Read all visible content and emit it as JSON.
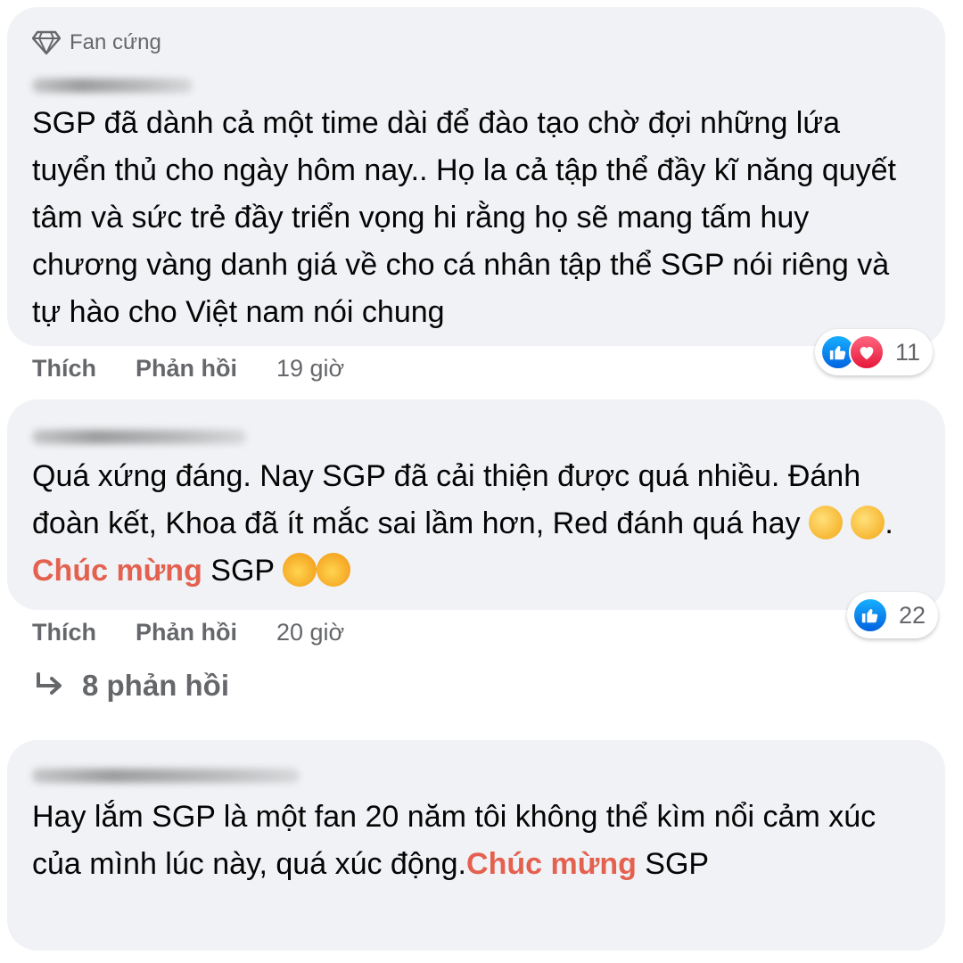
{
  "comments": [
    {
      "badge": "Fan cứng",
      "icon": "diamond-icon",
      "text": "SGP đã dành cả một time dài để đào tạo chờ đợi những lứa tuyển thủ cho ngày hôm nay.. Họ la cả tập thể đầy kĩ năng quyết tâm và sức trẻ đầy triển vọng hi rằng họ sẽ mang tấm huy chương vàng danh giá về cho cá nhân tập thể SGP nói riêng và tự hào cho Việt nam nói chung",
      "like": "Thích",
      "reply": "Phản hồi",
      "time": "19 giờ",
      "reactions": [
        "like",
        "love"
      ],
      "reaction_count": "11"
    },
    {
      "text_a": "Quá xứng đáng. Nay SGP đã cải thiện được quá nhiều. Đánh đoàn kết, Khoa đã ít mắc sai lầm hơn, Red đánh quá hay",
      "text_b": ". ",
      "highlight": "Chúc mừng",
      "text_c": " SGP",
      "emojis_a": [
        "clapping-hands-emoji",
        "clapping-hands-emoji"
      ],
      "emojis_b": [
        "partying-face-emoji",
        "partying-face-emoji"
      ],
      "like": "Thích",
      "reply": "Phản hồi",
      "time": "20 giờ",
      "reactions": [
        "like"
      ],
      "reaction_count": "22",
      "replies_label": "8 phản hồi"
    },
    {
      "text_a": "Hay lắm SGP là một fan 20 năm tôi không thể kìm nổi cảm xúc của mình lúc này, quá xúc động.",
      "highlight": "Chúc mừng",
      "text_c": " SGP"
    }
  ],
  "colors": {
    "bubble": "#f0f2f5",
    "highlight": "#e4614f",
    "secondary_text": "#65676b",
    "like_blue": "#1877f2",
    "love_red": "#f33e58"
  }
}
